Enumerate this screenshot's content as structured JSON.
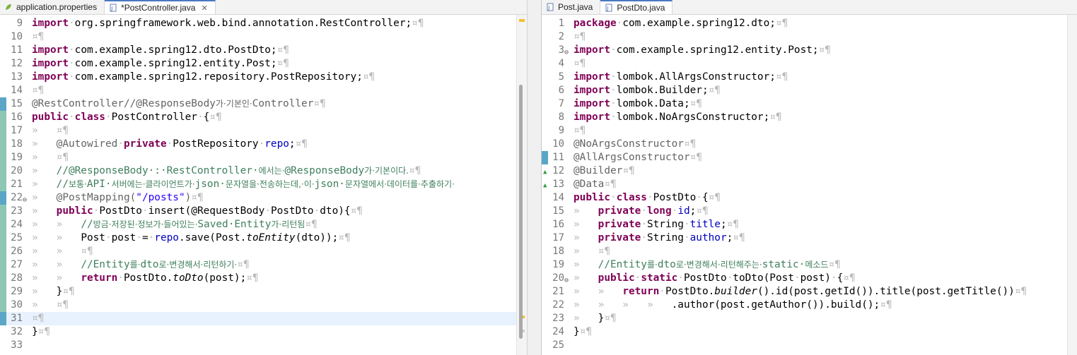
{
  "left_tabs": [
    {
      "label": "application.properties",
      "icon": "properties-file-icon",
      "active": false
    },
    {
      "label": "*PostController.java",
      "icon": "java-file-icon",
      "active": true,
      "close": "✕"
    }
  ],
  "right_tabs": [
    {
      "label": "Post.java",
      "icon": "java-file-icon",
      "active": false
    },
    {
      "label": "PostDto.java",
      "icon": "java-file-icon",
      "active": true
    }
  ],
  "left_code": [
    {
      "n": "9",
      "t": [
        [
          "kw",
          "import"
        ],
        [
          "ws",
          "·"
        ],
        [
          "",
          "org.springframework.web.bind.annotation.RestController;"
        ],
        [
          "ws",
          "¤¶"
        ]
      ]
    },
    {
      "n": "10",
      "t": [
        [
          "ws",
          "¤¶"
        ]
      ]
    },
    {
      "n": "11",
      "t": [
        [
          "kw",
          "import"
        ],
        [
          "ws",
          "·"
        ],
        [
          "",
          "com.example.spring12.dto.PostDto;"
        ],
        [
          "ws",
          "¤¶"
        ]
      ]
    },
    {
      "n": "12",
      "t": [
        [
          "kw",
          "import"
        ],
        [
          "ws",
          "·"
        ],
        [
          "",
          "com.example.spring12.entity.Post;"
        ],
        [
          "ws",
          "¤¶"
        ]
      ]
    },
    {
      "n": "13",
      "t": [
        [
          "kw",
          "import"
        ],
        [
          "ws",
          "·"
        ],
        [
          "",
          "com.example.spring12.repository.PostRepository;"
        ],
        [
          "ws",
          "¤¶"
        ]
      ]
    },
    {
      "n": "14",
      "t": [
        [
          "ws",
          "¤¶"
        ]
      ]
    },
    {
      "n": "15",
      "t": [
        [
          "ann",
          "@RestController//@ResponseBody"
        ],
        [
          "ann ko",
          "가·기본인·"
        ],
        [
          "ann",
          "Controller"
        ],
        [
          "ws",
          "¤¶"
        ]
      ]
    },
    {
      "n": "16",
      "t": [
        [
          "kw",
          "public"
        ],
        [
          "ws",
          "·"
        ],
        [
          "kw",
          "class"
        ],
        [
          "ws",
          "·"
        ],
        [
          "",
          "PostController"
        ],
        [
          "ws",
          "·"
        ],
        [
          "",
          "{"
        ],
        [
          "ws",
          "¤¶"
        ]
      ]
    },
    {
      "n": "17",
      "t": [
        [
          "ws",
          "»   ¤¶"
        ]
      ]
    },
    {
      "n": "18",
      "t": [
        [
          "ws",
          "»   "
        ],
        [
          "ann",
          "@Autowired"
        ],
        [
          "ws",
          "·"
        ],
        [
          "kw",
          "private"
        ],
        [
          "ws",
          "·"
        ],
        [
          "",
          "PostRepository"
        ],
        [
          "ws",
          "·"
        ],
        [
          "fld",
          "repo"
        ],
        [
          "",
          ";"
        ],
        [
          "ws",
          "¤¶"
        ]
      ]
    },
    {
      "n": "19",
      "t": [
        [
          "ws",
          "»   ¤¶"
        ]
      ]
    },
    {
      "n": "20",
      "t": [
        [
          "ws",
          "»   "
        ],
        [
          "cm",
          "//@ResponseBody·:·RestController·"
        ],
        [
          "cm ko",
          "에서는·"
        ],
        [
          "cm",
          "@ResponseBody"
        ],
        [
          "cm ko",
          "가·기본이다."
        ],
        [
          "ws",
          "¤¶"
        ]
      ]
    },
    {
      "n": "21",
      "t": [
        [
          "ws",
          "»   "
        ],
        [
          "cm",
          "//"
        ],
        [
          "cm ko",
          "보통·"
        ],
        [
          "cm",
          "API·"
        ],
        [
          "cm ko",
          "서버에는·클라이언트가·"
        ],
        [
          "cm",
          "json·"
        ],
        [
          "cm ko",
          "문자열을·전송하는데,·이·"
        ],
        [
          "cm",
          "json·"
        ],
        [
          "cm ko",
          "문자열에서·데이터를·추출하기·"
        ]
      ]
    },
    {
      "n": "22",
      "fold": "⊖",
      "t": [
        [
          "ws",
          "»   "
        ],
        [
          "ann",
          "@PostMapping("
        ],
        [
          "str",
          "\"/posts\""
        ],
        [
          "ann",
          ")"
        ],
        [
          "ws",
          "¤¶"
        ]
      ]
    },
    {
      "n": "23",
      "t": [
        [
          "ws",
          "»   "
        ],
        [
          "kw",
          "public"
        ],
        [
          "ws",
          "·"
        ],
        [
          "",
          "PostDto"
        ],
        [
          "ws",
          "·"
        ],
        [
          "",
          "insert(@RequestBody"
        ],
        [
          "ws",
          "·"
        ],
        [
          "",
          "PostDto"
        ],
        [
          "ws",
          "·"
        ],
        [
          "",
          "dto){"
        ],
        [
          "ws",
          "¤¶"
        ]
      ]
    },
    {
      "n": "24",
      "t": [
        [
          "ws",
          "»   »   "
        ],
        [
          "cm",
          "//"
        ],
        [
          "cm ko",
          "방금·저장된·정보가·들어있는·"
        ],
        [
          "cm",
          "Saved·Entity"
        ],
        [
          "cm ko",
          "가·리턴됨"
        ],
        [
          "ws",
          "¤¶"
        ]
      ]
    },
    {
      "n": "25",
      "t": [
        [
          "ws",
          "»   »   "
        ],
        [
          "",
          "Post"
        ],
        [
          "ws",
          "·"
        ],
        [
          "",
          "post"
        ],
        [
          "ws",
          "·"
        ],
        [
          "",
          "="
        ],
        [
          "ws",
          "·"
        ],
        [
          "fld",
          "repo"
        ],
        [
          "",
          ".save(Post."
        ],
        [
          "it",
          "toEntity"
        ],
        [
          "",
          "(dto));"
        ],
        [
          "ws",
          "¤¶"
        ]
      ]
    },
    {
      "n": "26",
      "t": [
        [
          "ws",
          "»   »   ¤¶"
        ]
      ]
    },
    {
      "n": "27",
      "t": [
        [
          "ws",
          "»   »   "
        ],
        [
          "cm",
          "//Entity"
        ],
        [
          "cm ko",
          "를·"
        ],
        [
          "cm",
          "dto"
        ],
        [
          "cm ko",
          "로·변경해서·리턴하기·"
        ],
        [
          "ws",
          "¤¶"
        ]
      ]
    },
    {
      "n": "28",
      "t": [
        [
          "ws",
          "»   »   "
        ],
        [
          "kw",
          "return"
        ],
        [
          "ws",
          "·"
        ],
        [
          "",
          "PostDto."
        ],
        [
          "it",
          "toDto"
        ],
        [
          "",
          "(post);"
        ],
        [
          "ws",
          "¤¶"
        ]
      ]
    },
    {
      "n": "29",
      "t": [
        [
          "ws",
          "»   "
        ],
        [
          "",
          "}"
        ],
        [
          "ws",
          "¤¶"
        ]
      ]
    },
    {
      "n": "30",
      "t": [
        [
          "ws",
          "»   ¤¶"
        ]
      ]
    },
    {
      "n": "31",
      "current": true,
      "t": [
        [
          "ws",
          "¤¶"
        ]
      ]
    },
    {
      "n": "32",
      "t": [
        [
          "",
          "}"
        ],
        [
          "ws",
          "¤¶"
        ]
      ]
    },
    {
      "n": "33",
      "t": []
    }
  ],
  "right_code": [
    {
      "n": "1",
      "t": [
        [
          "kw",
          "package"
        ],
        [
          "ws",
          "·"
        ],
        [
          "",
          "com.example.spring12.dto;"
        ],
        [
          "ws",
          "¤¶"
        ]
      ]
    },
    {
      "n": "2",
      "t": [
        [
          "ws",
          "¤¶"
        ]
      ]
    },
    {
      "n": "3",
      "fold": "⊖",
      "t": [
        [
          "kw",
          "import"
        ],
        [
          "ws",
          "·"
        ],
        [
          "",
          "com.example.spring12.entity.Post;"
        ],
        [
          "ws",
          "¤¶"
        ]
      ]
    },
    {
      "n": "4",
      "t": [
        [
          "ws",
          "¤¶"
        ]
      ]
    },
    {
      "n": "5",
      "t": [
        [
          "kw",
          "import"
        ],
        [
          "ws",
          "·"
        ],
        [
          "",
          "lombok.AllArgsConstructor;"
        ],
        [
          "ws",
          "¤¶"
        ]
      ]
    },
    {
      "n": "6",
      "t": [
        [
          "kw",
          "import"
        ],
        [
          "ws",
          "·"
        ],
        [
          "",
          "lombok.Builder;"
        ],
        [
          "ws",
          "¤¶"
        ]
      ]
    },
    {
      "n": "7",
      "t": [
        [
          "kw",
          "import"
        ],
        [
          "ws",
          "·"
        ],
        [
          "",
          "lombok.Data;"
        ],
        [
          "ws",
          "¤¶"
        ]
      ]
    },
    {
      "n": "8",
      "t": [
        [
          "kw",
          "import"
        ],
        [
          "ws",
          "·"
        ],
        [
          "",
          "lombok.NoArgsConstructor;"
        ],
        [
          "ws",
          "¤¶"
        ]
      ]
    },
    {
      "n": "9",
      "t": [
        [
          "ws",
          "¤¶"
        ]
      ]
    },
    {
      "n": "10",
      "t": [
        [
          "ann",
          "@NoArgsConstructor"
        ],
        [
          "ws",
          "¤¶"
        ]
      ]
    },
    {
      "n": "11",
      "t": [
        [
          "ann",
          "@AllArgsConstructor"
        ],
        [
          "ws",
          "¤¶"
        ]
      ]
    },
    {
      "n": "12",
      "ov": "▲",
      "t": [
        [
          "ann",
          "@Builder"
        ],
        [
          "ws",
          "¤¶"
        ]
      ]
    },
    {
      "n": "13",
      "ov": "▲",
      "t": [
        [
          "ann",
          "@Data"
        ],
        [
          "ws",
          "¤¶"
        ]
      ]
    },
    {
      "n": "14",
      "t": [
        [
          "kw",
          "public"
        ],
        [
          "ws",
          "·"
        ],
        [
          "kw",
          "class"
        ],
        [
          "ws",
          "·"
        ],
        [
          "",
          "PostDto"
        ],
        [
          "ws",
          "·"
        ],
        [
          "",
          "{"
        ],
        [
          "ws",
          "¤¶"
        ]
      ]
    },
    {
      "n": "15",
      "t": [
        [
          "ws",
          "»   "
        ],
        [
          "kw",
          "private"
        ],
        [
          "ws",
          "·"
        ],
        [
          "kw",
          "long"
        ],
        [
          "ws",
          "·"
        ],
        [
          "fld",
          "id"
        ],
        [
          "",
          ";"
        ],
        [
          "ws",
          "¤¶"
        ]
      ]
    },
    {
      "n": "16",
      "t": [
        [
          "ws",
          "»   "
        ],
        [
          "kw",
          "private"
        ],
        [
          "ws",
          "·"
        ],
        [
          "",
          "String"
        ],
        [
          "ws",
          "·"
        ],
        [
          "fld",
          "title"
        ],
        [
          "",
          ";"
        ],
        [
          "ws",
          "¤¶"
        ]
      ]
    },
    {
      "n": "17",
      "t": [
        [
          "ws",
          "»   "
        ],
        [
          "kw",
          "private"
        ],
        [
          "ws",
          "·"
        ],
        [
          "",
          "String"
        ],
        [
          "ws",
          "·"
        ],
        [
          "fld",
          "author"
        ],
        [
          "",
          ";"
        ],
        [
          "ws",
          "¤¶"
        ]
      ]
    },
    {
      "n": "18",
      "t": [
        [
          "ws",
          "»   ¤¶"
        ]
      ]
    },
    {
      "n": "19",
      "t": [
        [
          "ws",
          "»   "
        ],
        [
          "cm",
          "//Entity"
        ],
        [
          "cm ko",
          "를·"
        ],
        [
          "cm",
          "dto"
        ],
        [
          "cm ko",
          "로·변경해서·리턴해주는·"
        ],
        [
          "cm",
          "static·"
        ],
        [
          "cm ko",
          "메소드"
        ],
        [
          "ws",
          "¤¶"
        ]
      ]
    },
    {
      "n": "20",
      "fold": "⊖",
      "t": [
        [
          "ws",
          "»   "
        ],
        [
          "kw",
          "public"
        ],
        [
          "ws",
          "·"
        ],
        [
          "kw",
          "static"
        ],
        [
          "ws",
          "·"
        ],
        [
          "",
          "PostDto"
        ],
        [
          "ws",
          "·"
        ],
        [
          "",
          "toDto(Post"
        ],
        [
          "ws",
          "·"
        ],
        [
          "",
          "post)"
        ],
        [
          "ws",
          "·"
        ],
        [
          "",
          "{"
        ],
        [
          "ws",
          "¤¶"
        ]
      ]
    },
    {
      "n": "21",
      "t": [
        [
          "ws",
          "»   »   "
        ],
        [
          "kw",
          "return"
        ],
        [
          "ws",
          "·"
        ],
        [
          "",
          "PostDto."
        ],
        [
          "it",
          "builder"
        ],
        [
          "",
          "().id(post.getId()).title(post.getTitle())"
        ],
        [
          "ws",
          "¤¶"
        ]
      ]
    },
    {
      "n": "22",
      "t": [
        [
          "ws",
          "»   »   »   »   "
        ],
        [
          "",
          ".author(post.getAuthor()).build();"
        ],
        [
          "ws",
          "¤¶"
        ]
      ]
    },
    {
      "n": "23",
      "t": [
        [
          "ws",
          "»   "
        ],
        [
          "",
          "}"
        ],
        [
          "ws",
          "¤¶"
        ]
      ]
    },
    {
      "n": "24",
      "t": [
        [
          "",
          "}"
        ],
        [
          "ws",
          "¤¶"
        ]
      ]
    },
    {
      "n": "25",
      "t": []
    }
  ]
}
